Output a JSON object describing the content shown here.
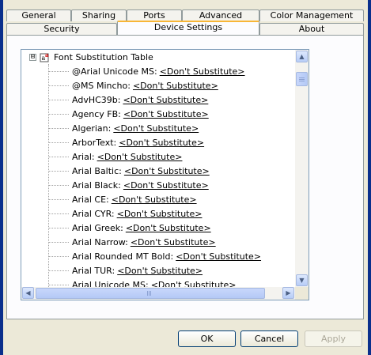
{
  "tabs_row1": [
    {
      "label": "General"
    },
    {
      "label": "Sharing"
    },
    {
      "label": "Ports"
    },
    {
      "label": "Advanced"
    },
    {
      "label": "Color Management"
    }
  ],
  "tabs_row2": [
    {
      "label": "Security"
    },
    {
      "label": "Device Settings",
      "active": true
    },
    {
      "label": "About"
    }
  ],
  "tree": {
    "root_label": "Font Substitution Table",
    "expander_symbol": "⊟",
    "items": [
      {
        "font": "@Arial Unicode MS:",
        "value": "<Don't Substitute>"
      },
      {
        "font": "@MS Mincho:",
        "value": "<Don't Substitute>"
      },
      {
        "font": "AdvHC39b:",
        "value": "<Don't Substitute>"
      },
      {
        "font": "Agency FB:",
        "value": "<Don't Substitute>"
      },
      {
        "font": "Algerian:",
        "value": "<Don't Substitute>"
      },
      {
        "font": "ArborText:",
        "value": "<Don't Substitute>"
      },
      {
        "font": "Arial:",
        "value": "<Don't Substitute>"
      },
      {
        "font": "Arial Baltic:",
        "value": "<Don't Substitute>"
      },
      {
        "font": "Arial Black:",
        "value": "<Don't Substitute>"
      },
      {
        "font": "Arial CE:",
        "value": "<Don't Substitute>"
      },
      {
        "font": "Arial CYR:",
        "value": "<Don't Substitute>"
      },
      {
        "font": "Arial Greek:",
        "value": "<Don't Substitute>"
      },
      {
        "font": "Arial Narrow:",
        "value": "<Don't Substitute>"
      },
      {
        "font": "Arial Rounded MT Bold:",
        "value": "<Don't Substitute>"
      },
      {
        "font": "Arial TUR:",
        "value": "<Don't Substitute>"
      },
      {
        "font": "Arial Unicode MS:",
        "value": "<Don't Substitute>"
      }
    ]
  },
  "scrollbar": {
    "up_arrow": "▲",
    "down_arrow": "▼",
    "left_arrow": "◀",
    "right_arrow": "▶",
    "vertical_position": 0.0
  },
  "buttons": {
    "ok": "OK",
    "cancel": "Cancel",
    "apply": "Apply"
  },
  "colors": {
    "tab_highlight": "#f8b636",
    "window_frame": "#0a2f8c",
    "dialog_bg": "#ece9d8"
  }
}
